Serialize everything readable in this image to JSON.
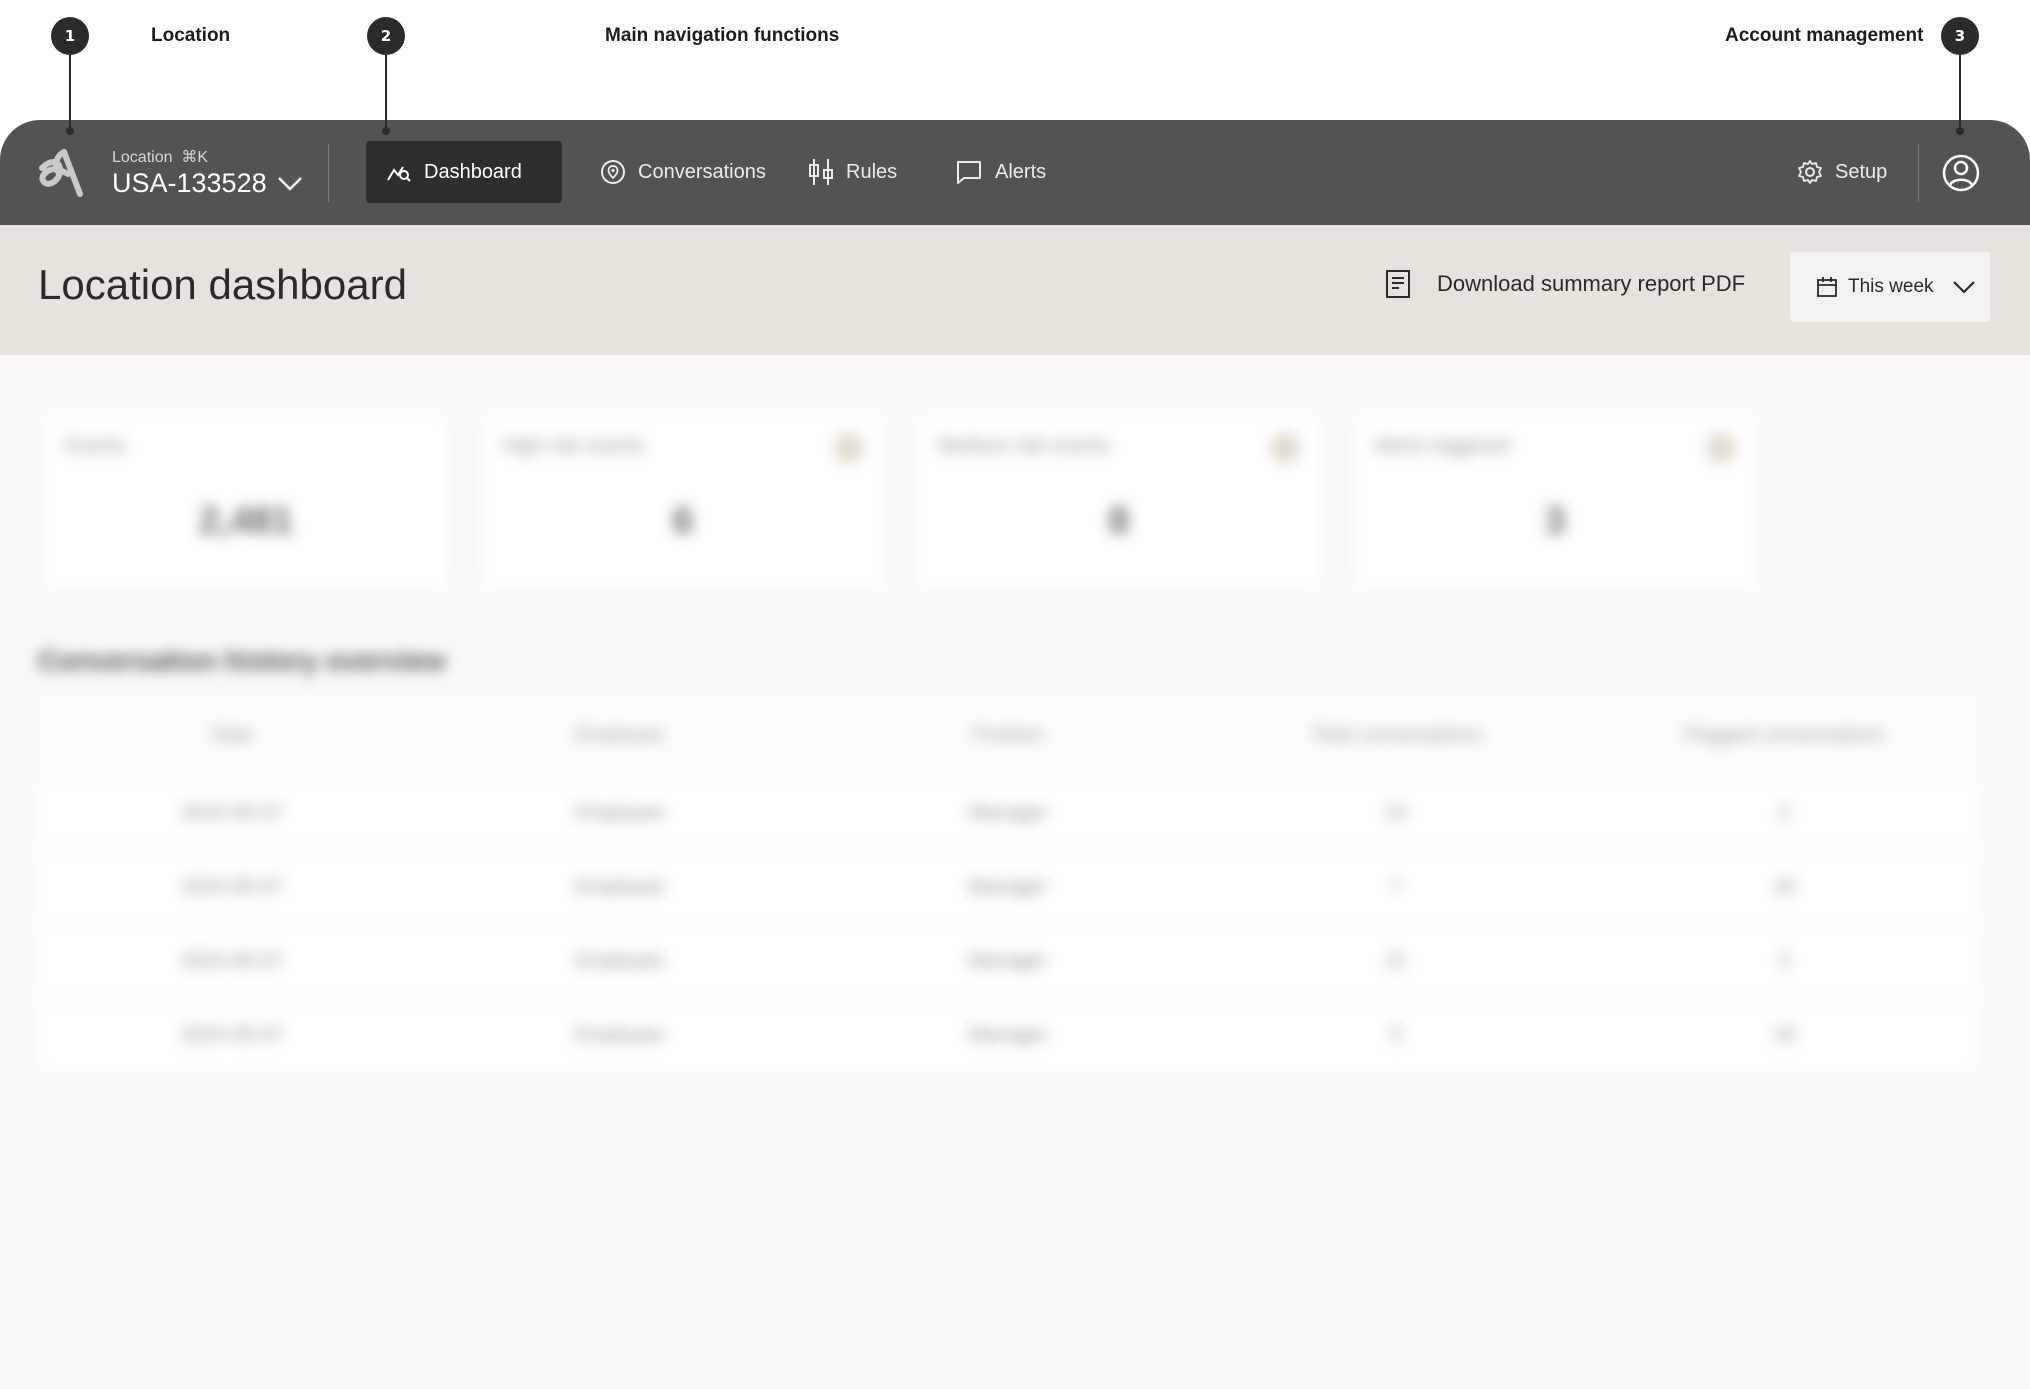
{
  "annotations": [
    {
      "number": "1",
      "label": "Location"
    },
    {
      "number": "2",
      "label": "Main navigation functions"
    },
    {
      "number": "3",
      "label": "Account management"
    }
  ],
  "location": {
    "label": "Location",
    "shortcut": "⌘K",
    "selected": "USA-133528"
  },
  "nav": {
    "items": [
      {
        "label": "Dashboard",
        "icon": "chart-search-icon",
        "active": true
      },
      {
        "label": "Conversations",
        "icon": "location-chat-icon",
        "active": false
      },
      {
        "label": "Rules",
        "icon": "sliders-icon",
        "active": false
      },
      {
        "label": "Alerts",
        "icon": "message-icon",
        "active": false
      }
    ],
    "setup_label": "Setup"
  },
  "page": {
    "title": "Location dashboard",
    "download_label": "Download summary report PDF",
    "date_range": "This week"
  },
  "metrics": [
    {
      "title": "Events",
      "value": "2,481"
    },
    {
      "title": "High risk events",
      "value": "6"
    },
    {
      "title": "Medium risk events",
      "value": "8"
    },
    {
      "title": "Alerts triggered",
      "value": "3"
    }
  ],
  "table": {
    "title": "Conversation history overview",
    "headers": [
      "Date",
      "Employee",
      "Position",
      "Total conversations",
      "Flagged conversations"
    ],
    "rows": [
      [
        "2024-05-07",
        "Employee",
        "Manager",
        "24",
        "2"
      ],
      [
        "2024-05-07",
        "Employee",
        "Manager",
        "7",
        "18"
      ],
      [
        "2024-05-07",
        "Employee",
        "Manager",
        "21",
        "3"
      ],
      [
        "2024-05-07",
        "Employee",
        "Manager",
        "5",
        "19"
      ]
    ]
  },
  "colors": {
    "topbar": "#535353",
    "active_nav": "#2e2e2e",
    "subheader": "#e6e2dc",
    "annotation": "#2b2b2b"
  }
}
